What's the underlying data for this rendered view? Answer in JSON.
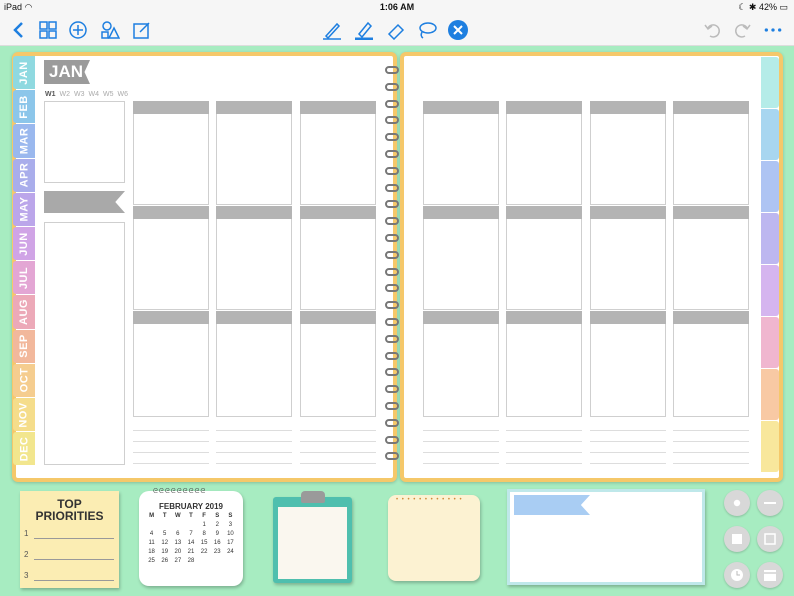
{
  "status": {
    "device": "iPad",
    "time": "1:06 AM",
    "battery": "42%"
  },
  "toolbar": {
    "back_icon": "chevron-left-icon",
    "items": [
      "grid-icon",
      "add-icon",
      "shapes-icon",
      "edit-icon",
      "pen-icon",
      "highlighter-icon",
      "eraser-icon",
      "lasso-icon",
      "close-circle-icon",
      "undo-icon",
      "redo-icon",
      "more-icon"
    ],
    "accent": "#1e7fe0"
  },
  "planner": {
    "month": "JAN",
    "weeks": [
      "W1",
      "W2",
      "W3",
      "W4",
      "W5",
      "W6"
    ],
    "active_week": "W1",
    "months": [
      {
        "label": "JAN",
        "color": "#8fd9e0"
      },
      {
        "label": "FEB",
        "color": "#8cc6ea"
      },
      {
        "label": "MAR",
        "color": "#9ab8ee"
      },
      {
        "label": "APR",
        "color": "#a9adeb"
      },
      {
        "label": "MAY",
        "color": "#bba6ea"
      },
      {
        "label": "JUN",
        "color": "#d0a4e6"
      },
      {
        "label": "JUL",
        "color": "#e3a6d4"
      },
      {
        "label": "AUG",
        "color": "#eca9b8"
      },
      {
        "label": "SEP",
        "color": "#f2b89c"
      },
      {
        "label": "OCT",
        "color": "#f5cd8f"
      },
      {
        "label": "NOV",
        "color": "#f5dd8b"
      },
      {
        "label": "DEC",
        "color": "#f2e68e"
      }
    ],
    "right_tab_colors": [
      "#b5ece8",
      "#a8d6f0",
      "#aec4f3",
      "#bdb7f0",
      "#d5b5ef",
      "#f0b6cf",
      "#f8c9a4",
      "#f8e79c"
    ]
  },
  "stickers": {
    "priorities": {
      "title_line1": "TOP",
      "title_line2": "PRIORITIES",
      "numbers": [
        "1",
        "2",
        "3"
      ]
    },
    "calendar": {
      "title": "FEBRUARY 2019",
      "weekdays": [
        "M",
        "T",
        "W",
        "T",
        "F",
        "S",
        "S"
      ],
      "days": [
        "",
        "",
        "",
        "",
        "1",
        "2",
        "3",
        "4",
        "5",
        "6",
        "7",
        "8",
        "9",
        "10",
        "11",
        "12",
        "13",
        "14",
        "15",
        "16",
        "17",
        "18",
        "19",
        "20",
        "21",
        "22",
        "23",
        "24",
        "25",
        "26",
        "27",
        "28",
        "",
        "",
        ""
      ]
    }
  },
  "side_buttons": [
    "record-icon",
    "minus-icon",
    "stop-icon",
    "square-icon",
    "clock-icon",
    "calendar-icon"
  ]
}
